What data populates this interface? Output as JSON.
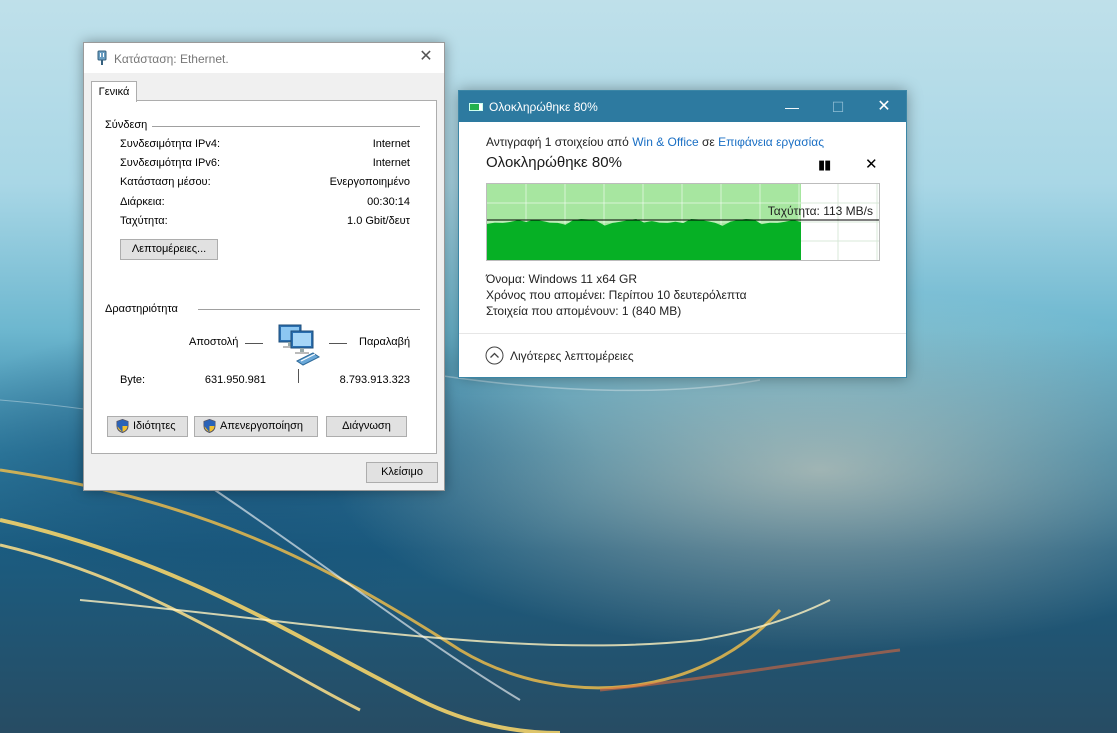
{
  "ethernet_dialog": {
    "title": "Κατάσταση: Ethernet.",
    "tab": "Γενικά",
    "connection": {
      "heading": "Σύνδεση",
      "rows": [
        {
          "label": "Συνδεσιμότητα IPv4:",
          "value": "Internet"
        },
        {
          "label": "Συνδεσιμότητα IPv6:",
          "value": "Internet"
        },
        {
          "label": "Κατάσταση μέσου:",
          "value": "Ενεργοποιημένο"
        },
        {
          "label": "Διάρκεια:",
          "value": "00:30:14"
        },
        {
          "label": "Ταχύτητα:",
          "value": "1.0 Gbit/δευτ"
        }
      ],
      "details_button": "Λεπτομέρειες..."
    },
    "activity": {
      "heading": "Δραστηριότητα",
      "sent_label": "Αποστολή",
      "received_label": "Παραλαβή",
      "bytes_label": "Byte:",
      "bytes_sent": "631.950.981",
      "bytes_received": "8.793.913.323"
    },
    "buttons": {
      "properties": "Ιδιότητες",
      "disable": "Απενεργοποίηση",
      "diagnose": "Διάγνωση"
    },
    "close_button": "Κλείσιμο"
  },
  "copy_dialog": {
    "title": "Ολοκληρώθηκε 80%",
    "copy_prefix": "Αντιγραφή 1 στοιχείου από",
    "source": "Win & Office",
    "copy_middle": "σε",
    "destination": "Επιφάνεια εργασίας",
    "progress_heading": "Ολοκληρώθηκε 80%",
    "progress": 0.8,
    "speed_text": "Ταχύτητα: 113 MB/s",
    "details": [
      {
        "label": "Όνομα:",
        "value": "Windows 11 x64 GR"
      },
      {
        "label": "Χρόνος που απομένει:",
        "value": "Περίπου 10 δευτερόλεπτα"
      },
      {
        "label": "Στοιχεία που απομένουν:",
        "value": "1 (840 MB)"
      }
    ],
    "less_details": "Λιγότερες λεπτομέρειες",
    "colors": {
      "titlebar": "#2d7aa0",
      "graph_fill": "#06b025",
      "graph_bg": "#a7e6a0"
    }
  }
}
